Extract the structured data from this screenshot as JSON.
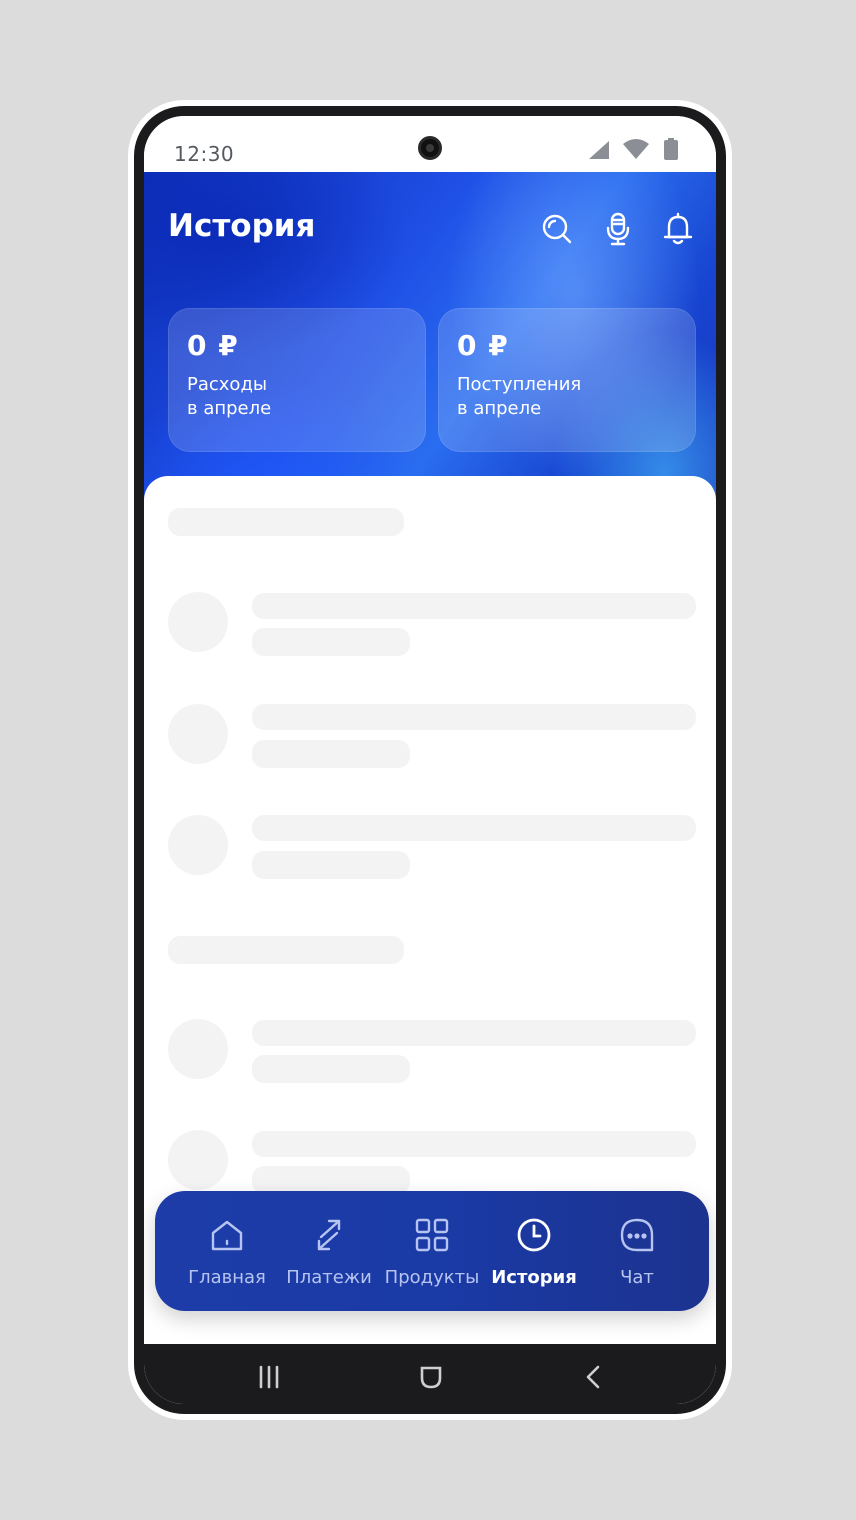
{
  "status_bar": {
    "time": "12:30",
    "icons": [
      "signal-icon",
      "wifi-icon",
      "battery-icon"
    ]
  },
  "header": {
    "title": "История",
    "actions": [
      "search-icon",
      "microphone-icon",
      "bell-icon"
    ]
  },
  "summary_cards": [
    {
      "amount": "0 ₽",
      "label_line1": "Расходы",
      "label_line2": "в апреле"
    },
    {
      "amount": "0 ₽",
      "label_line1": "Поступления",
      "label_line2": "в апреле"
    }
  ],
  "content": {
    "state": "loading-skeleton",
    "groups": [
      {
        "rows": 3
      },
      {
        "rows": 2
      }
    ]
  },
  "bottom_nav": {
    "items": [
      {
        "label": "Главная",
        "icon": "home-icon",
        "active": false
      },
      {
        "label": "Платежи",
        "icon": "transfer-arrows-icon",
        "active": false
      },
      {
        "label": "Продукты",
        "icon": "grid-icon",
        "active": false
      },
      {
        "label": "История",
        "icon": "clock-icon",
        "active": true
      },
      {
        "label": "Чат",
        "icon": "chat-bubble-icon",
        "active": false
      }
    ]
  },
  "system_nav": [
    "recents-icon",
    "home-button-icon",
    "back-icon"
  ],
  "colors": {
    "brand_blue": "#1a3aa6",
    "hero_gradient_start": "#0d2fb8",
    "hero_gradient_end": "#2a6df0",
    "nav_inactive": "#b7c4f2",
    "nav_active": "#ffffff",
    "skeleton": "#f3f3f4"
  }
}
